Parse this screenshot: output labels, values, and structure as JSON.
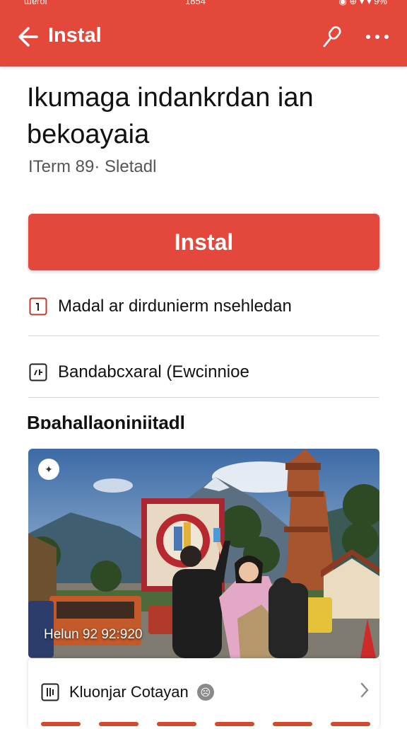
{
  "status_bar": {
    "left": "ɯɐɾol",
    "center": "1854",
    "right": "◉ ⊕ ▾ ▾ 9%"
  },
  "app_bar": {
    "title": "Instal"
  },
  "header": {
    "title": "Ikumaga indankrdan ian bekoayaia",
    "subtitle": "ITerm 89· Sletadl"
  },
  "install_button": {
    "label": "Instal"
  },
  "rows": [
    {
      "icon": "info-icon",
      "label": "Madal ar dirdunierm nsehledan"
    },
    {
      "icon": "media-icon",
      "label": "Bandabcxaral (Ewcinnioe"
    }
  ],
  "section": {
    "title": "Bɒahallaoniniitadl"
  },
  "photo": {
    "caption": "Helun 92 92:920",
    "badge_icon": "star-icon"
  },
  "card": {
    "row_label": "Kluonjar Cotayan",
    "row_icon": "list-icon",
    "chevron": "›"
  },
  "colors": {
    "accent": "#e3483b",
    "text": "#111111",
    "muted": "#555555"
  }
}
